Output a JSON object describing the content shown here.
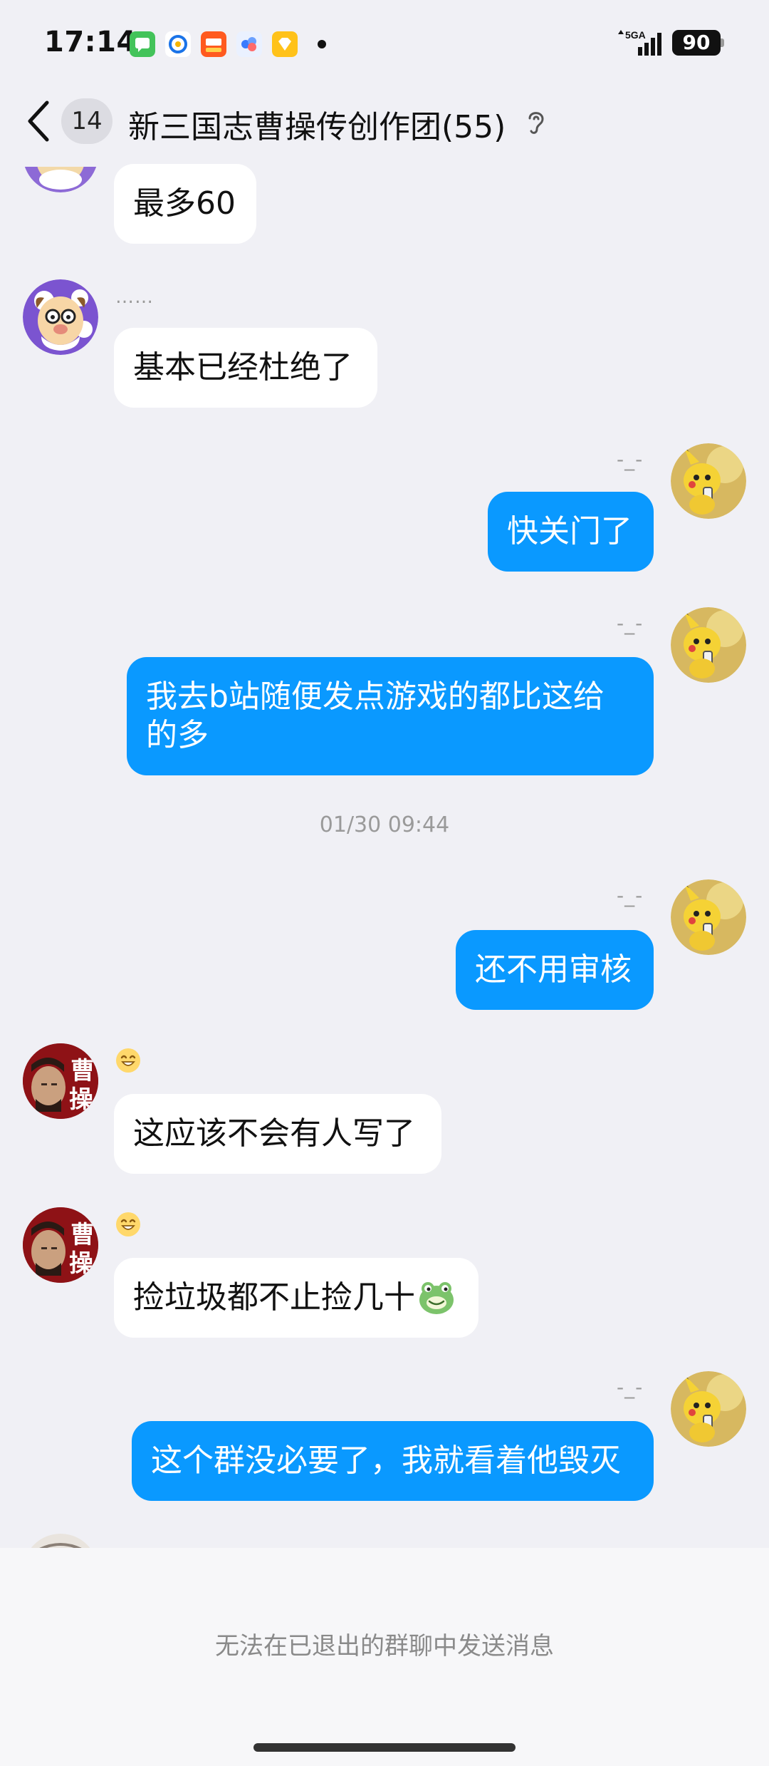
{
  "status_bar": {
    "time": "17:14",
    "network": "5GA",
    "battery": "90",
    "notification_icons": [
      "messages-app-icon",
      "email-app-icon",
      "shopping-app-icon",
      "cloud-app-icon",
      "diamond-app-icon"
    ]
  },
  "header": {
    "back_icon": "chevron-left-icon",
    "unread_count": "14",
    "title": "新三国志曹操传创作团(55)",
    "mode_icon": "ear-icon"
  },
  "messages": [
    {
      "side": "in",
      "sender": "",
      "text": "最多60"
    },
    {
      "side": "in",
      "sender": "……",
      "text": "基本已经杜绝了"
    },
    {
      "side": "out",
      "sender": "-_-",
      "text": "快关门了"
    },
    {
      "side": "out",
      "sender": "-_-",
      "text": "我去b站随便发点游戏的都比这给的多"
    },
    {
      "side": "out",
      "sender": "-_-",
      "text": "还不用审核"
    },
    {
      "side": "in",
      "sender_emoji": "grin-emoji",
      "avatar_text": "曹操",
      "text": "这应该不会有人写了"
    },
    {
      "side": "in",
      "sender_emoji": "grin-emoji",
      "avatar_text": "曹操",
      "text": "捡垃圾都不止捡几十",
      "trailing_emoji": "frog-emoji"
    },
    {
      "side": "out",
      "sender": "-_-",
      "text": "这个群没必要了，我就看着他毁灭"
    }
  ],
  "timestamp": "01/30 09:44",
  "footer": {
    "notice": "无法在已退出的群聊中发送消息"
  },
  "colors": {
    "background": "#f0f0f5",
    "outgoing_bubble": "#0a99ff",
    "incoming_bubble": "#ffffff"
  }
}
